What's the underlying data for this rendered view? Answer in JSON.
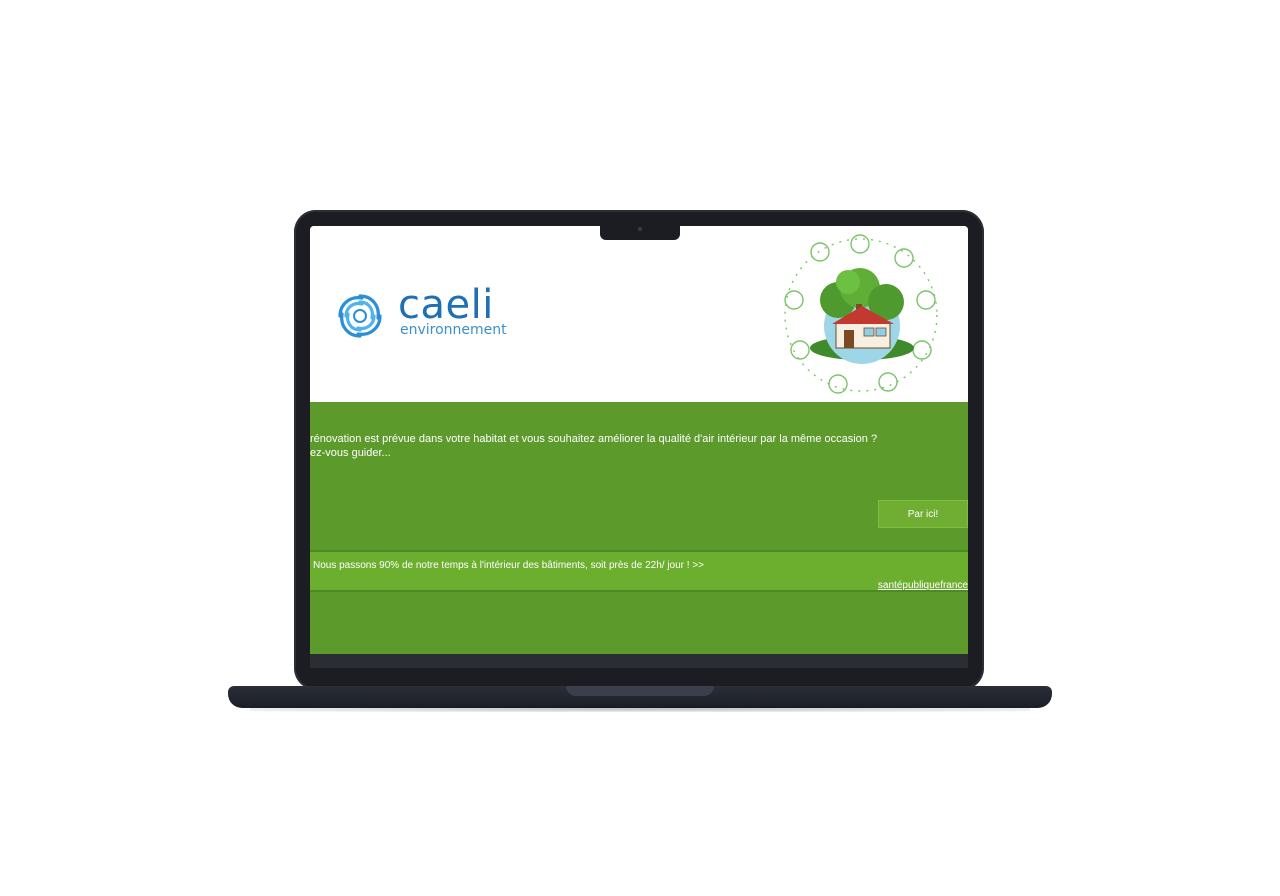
{
  "brand": {
    "name": "caeli",
    "subtitle": "environnement",
    "primary_color": "#1f6fb5"
  },
  "illustration": {
    "icon": "eco-house-illustration"
  },
  "hero": {
    "line1": "rénovation est prévue dans votre habitat et vous souhaitez améliorer la qualité d'air intérieur par la même occasion ?",
    "line2": "ez-vous guider...",
    "cta_label": "Par ici!",
    "band_color": "#5c9a2c"
  },
  "quote": {
    "text": "Nous passons 90% de notre temps à l'intérieur des bâtiments, soit près de 22h/ jour ! >>",
    "source": "santépubliquefrance"
  }
}
